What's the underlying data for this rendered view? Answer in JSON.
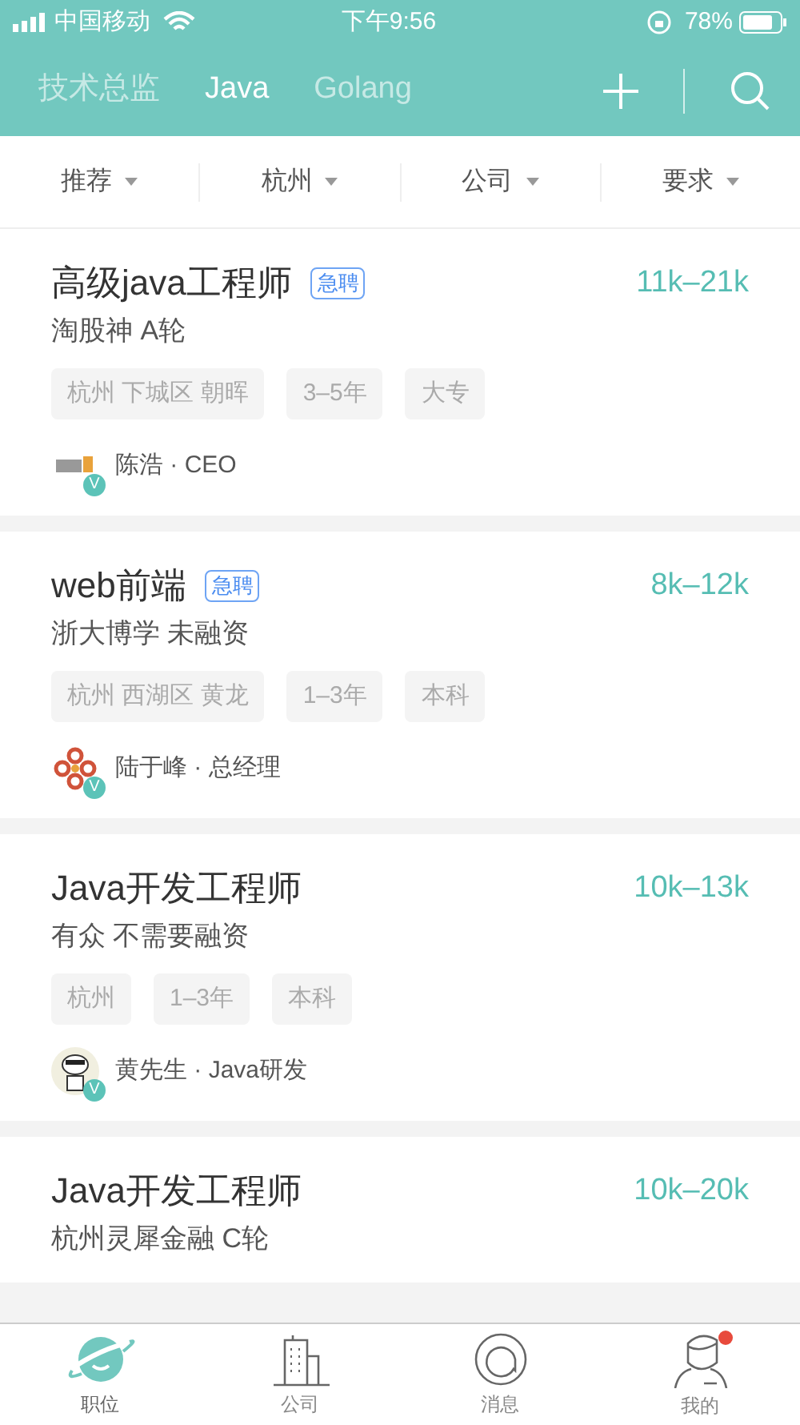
{
  "status_bar": {
    "carrier": "中国移动",
    "time": "下午9:56",
    "battery": "78%"
  },
  "header": {
    "tabs": [
      {
        "label": "技术总监",
        "selected": false
      },
      {
        "label": "Java",
        "selected": true
      },
      {
        "label": "Golang",
        "selected": false
      }
    ]
  },
  "filters": [
    "推荐",
    "杭州",
    "公司",
    "要求"
  ],
  "jobs": [
    {
      "title": "高级java工程师",
      "urgent": "急聘",
      "salary": "11k–21k",
      "company": "淘股神 A轮",
      "tags": [
        "杭州 下城区 朝晖",
        "3–5年",
        "大专"
      ],
      "recruiter": "陈浩 · CEO",
      "verified": "V",
      "kind": "logo"
    },
    {
      "title": "web前端",
      "urgent": "急聘",
      "salary": "8k–12k",
      "company": "浙大博学 未融资",
      "tags": [
        "杭州 西湖区 黄龙",
        "1–3年",
        "本科"
      ],
      "recruiter": "陆于峰 · 总经理",
      "verified": "V",
      "kind": "flower"
    },
    {
      "title": "Java开发工程师",
      "salary": "10k–13k",
      "company": "有众 不需要融资",
      "tags": [
        "杭州",
        "1–3年",
        "本科"
      ],
      "recruiter": "黄先生 · Java研发",
      "verified": "V",
      "kind": "dog"
    },
    {
      "title": "Java开发工程师",
      "salary": "10k–20k",
      "company": "杭州灵犀金融 C轮"
    }
  ],
  "tab_bar": [
    {
      "label": "职位",
      "selected": true,
      "kind": "planet",
      "dot": false
    },
    {
      "label": "公司",
      "selected": false,
      "kind": "building",
      "dot": false
    },
    {
      "label": "消息",
      "selected": false,
      "kind": "chat",
      "dot": false
    },
    {
      "label": "我的",
      "selected": false,
      "kind": "person",
      "dot": true
    }
  ]
}
